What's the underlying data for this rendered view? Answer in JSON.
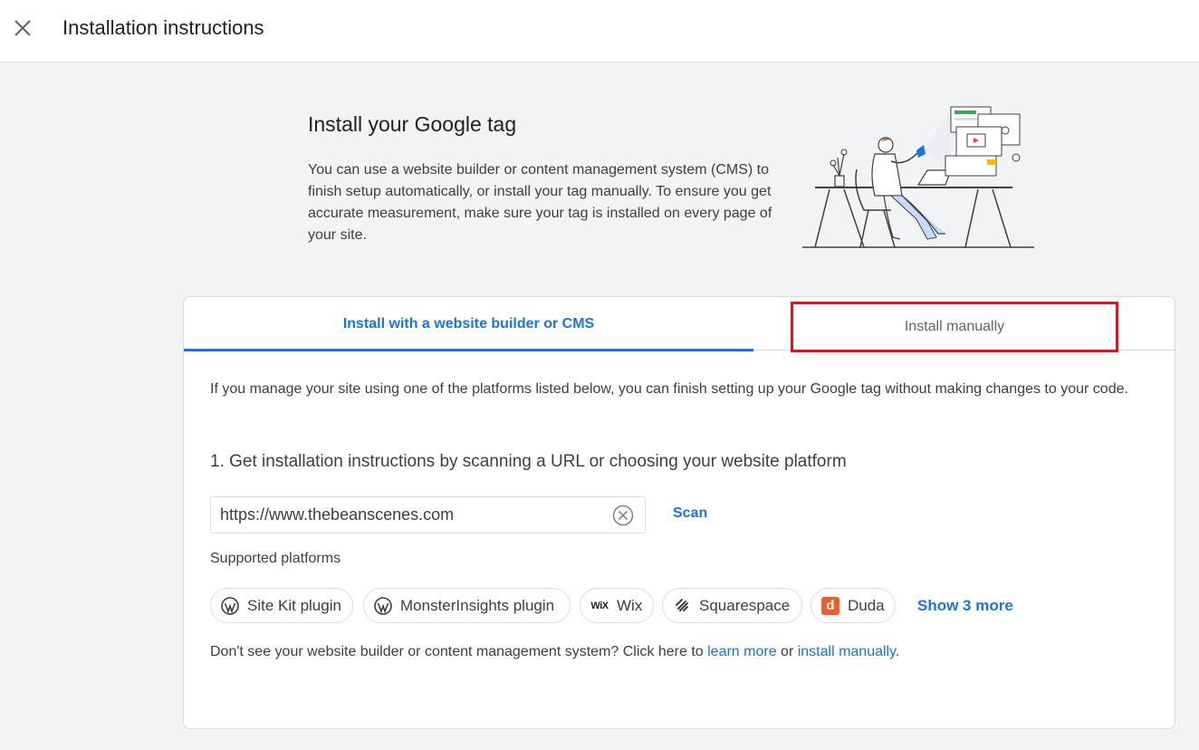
{
  "header": {
    "title": "Installation instructions"
  },
  "intro": {
    "title": "Install your Google tag",
    "text": "You can use a website builder or content management system (CMS) to finish setup automatically, or install your tag manually. To ensure you get accurate measurement, make sure your tag is installed on every page of your site."
  },
  "tabs": {
    "cms_label": "Install with a website builder or CMS",
    "manual_label": "Install manually"
  },
  "content": {
    "description": "If you manage your site using one of the platforms listed below, you can finish setting up your Google tag without making changes to your code.",
    "step_title": "1. Get installation instructions by scanning a URL or choosing your website platform",
    "url_value": "https://www.thebeanscenes.com",
    "scan_label": "Scan",
    "supported_label": "Supported platforms",
    "platforms": [
      {
        "label": "Site Kit plugin",
        "icon": "wordpress-icon"
      },
      {
        "label": "MonsterInsights plugin",
        "icon": "wordpress-icon"
      },
      {
        "label": "Wix",
        "icon": "wix-icon",
        "logo_text": "WiX"
      },
      {
        "label": "Squarespace",
        "icon": "squarespace-icon"
      },
      {
        "label": "Duda",
        "icon": "duda-icon",
        "logo_text": "d"
      }
    ],
    "show_more_label": "Show 3 more",
    "footer_prefix": "Don't see your website builder or content management system? Click here to ",
    "footer_link1": "learn more",
    "footer_middle": " or ",
    "footer_link2": "install manually",
    "footer_suffix": "."
  },
  "colors": {
    "accent": "#1a73e8",
    "highlight_box": "#e8101c"
  }
}
